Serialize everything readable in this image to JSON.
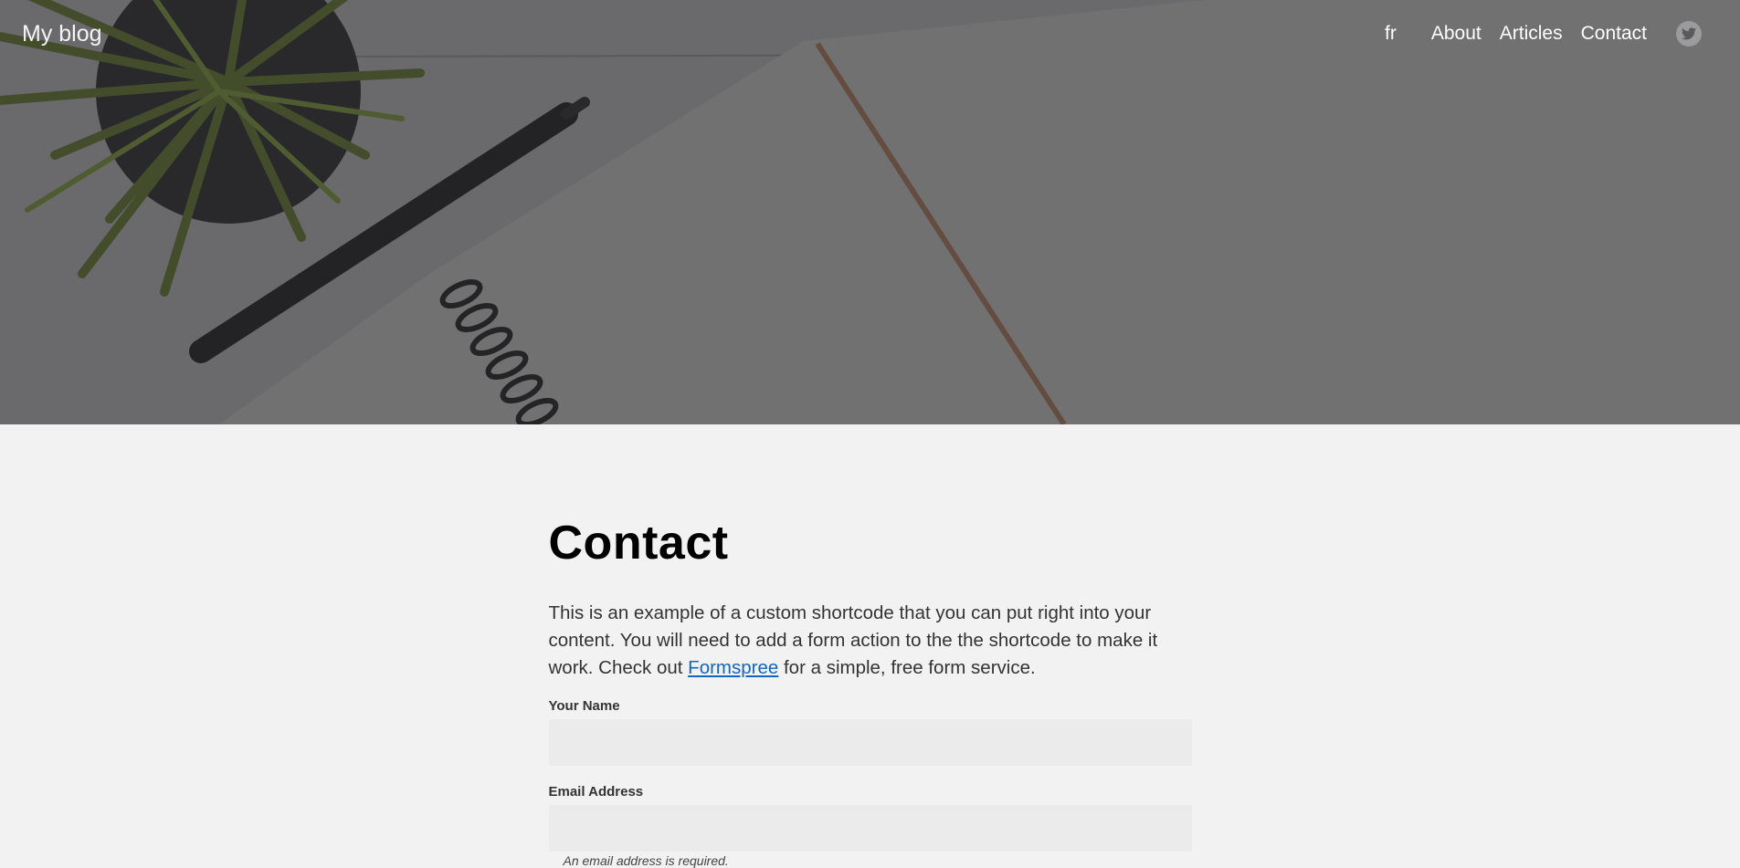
{
  "header": {
    "brand": "My blog",
    "language_link": "fr",
    "nav": [
      "About",
      "Articles",
      "Contact"
    ],
    "social_icon": "twitter-icon"
  },
  "main": {
    "title": "Contact",
    "intro_before": "This is an example of a custom shortcode that you can put right into your content. You will need to add a form action to the the shortcode to make it work. Check out ",
    "intro_link": "Formspree",
    "intro_after": " for a simple, free form service.",
    "form": {
      "name_label": "Your Name",
      "name_value": "",
      "email_label": "Email Address",
      "email_value": "",
      "email_hint": "An email address is required."
    }
  },
  "colors": {
    "background": "#f2f2f2",
    "link": "#1565c0",
    "input_bg": "#ebebeb"
  }
}
